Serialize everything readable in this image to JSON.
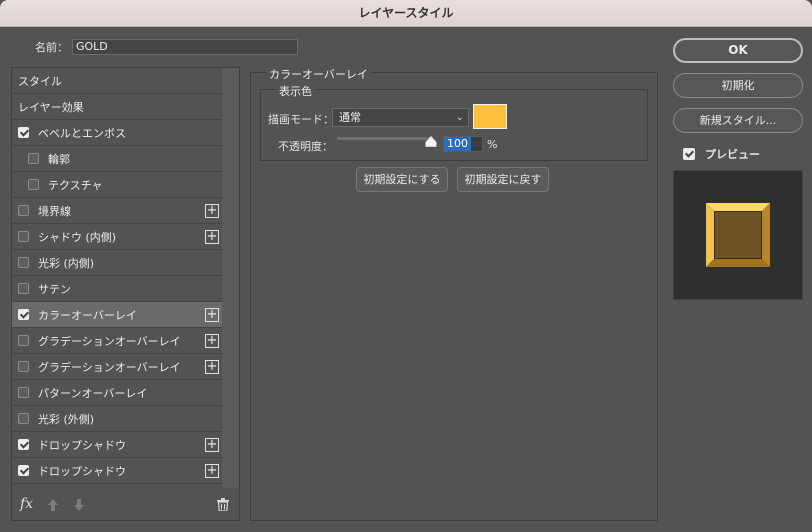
{
  "window": {
    "title": "レイヤースタイル"
  },
  "name_field": {
    "label": "名前：",
    "value": "GOLD"
  },
  "style_list": {
    "items": [
      {
        "label": "スタイル",
        "type": "header",
        "checked": false,
        "plus": false,
        "selected": false
      },
      {
        "label": "レイヤー効果",
        "type": "header",
        "checked": false,
        "plus": false,
        "selected": false
      },
      {
        "label": "ベベルとエンボス",
        "type": "check",
        "checked": true,
        "plus": false,
        "selected": false
      },
      {
        "label": "輪郭",
        "type": "indent",
        "checked": false,
        "plus": false,
        "selected": false
      },
      {
        "label": "テクスチャ",
        "type": "indent",
        "checked": false,
        "plus": false,
        "selected": false
      },
      {
        "label": "境界線",
        "type": "check",
        "checked": false,
        "plus": true,
        "selected": false
      },
      {
        "label": "シャドウ (内側)",
        "type": "check",
        "checked": false,
        "plus": true,
        "selected": false
      },
      {
        "label": "光彩 (内側)",
        "type": "check",
        "checked": false,
        "plus": false,
        "selected": false
      },
      {
        "label": "サテン",
        "type": "check",
        "checked": false,
        "plus": false,
        "selected": false
      },
      {
        "label": "カラーオーバーレイ",
        "type": "check",
        "checked": true,
        "plus": true,
        "selected": true
      },
      {
        "label": "グラデーションオーバーレイ",
        "type": "check",
        "checked": false,
        "plus": true,
        "selected": false
      },
      {
        "label": "グラデーションオーバーレイ",
        "type": "check",
        "checked": false,
        "plus": true,
        "selected": false
      },
      {
        "label": "パターンオーバーレイ",
        "type": "check",
        "checked": false,
        "plus": false,
        "selected": false
      },
      {
        "label": "光彩 (外側)",
        "type": "check",
        "checked": false,
        "plus": false,
        "selected": false
      },
      {
        "label": "ドロップシャドウ",
        "type": "check",
        "checked": true,
        "plus": true,
        "selected": false
      },
      {
        "label": "ドロップシャドウ",
        "type": "check",
        "checked": true,
        "plus": true,
        "selected": false
      }
    ],
    "plus_glyph": "+",
    "fx_label": "fx"
  },
  "color_overlay": {
    "group_title": "カラーオーバーレイ",
    "subgroup_title": "表示色",
    "blend_mode_label": "描画モード：",
    "blend_mode_value": "通常",
    "color": "#ffc13b",
    "opacity_label": "不透明度：",
    "opacity_value": "100",
    "opacity_unit": "%",
    "opacity_fraction": 1.0,
    "make_default_label": "初期設定にする",
    "reset_default_label": "初期設定に戻す"
  },
  "right": {
    "ok_label": "OK",
    "reset_label": "初期化",
    "new_style_label": "新規スタイル...",
    "preview_label": "プレビュー",
    "preview_checked": true
  },
  "icons": {
    "chevron": "chevron-down-icon",
    "thumb": "slider-thumb-icon",
    "trash": "trash-icon",
    "up": "move-up-icon",
    "down": "move-down-icon"
  }
}
